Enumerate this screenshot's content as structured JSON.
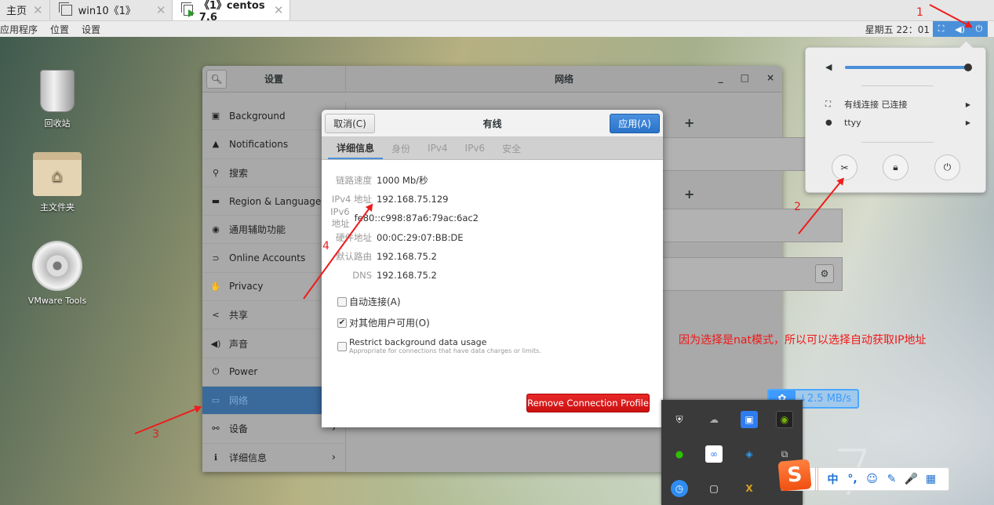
{
  "vmware_tabs": [
    {
      "label": "主页",
      "active": false
    },
    {
      "label": "win10《1》",
      "active": false
    },
    {
      "label": "《1》centos 7.6",
      "active": true
    }
  ],
  "topbar": {
    "menus": [
      "应用程序",
      "位置",
      "设置"
    ],
    "clock": "星期五 22：01",
    "icons": [
      "network-icon",
      "volume-icon",
      "power-icon"
    ]
  },
  "desktop_icons": [
    {
      "label": "回收站",
      "icon": "trash-icon"
    },
    {
      "label": "主文件夹",
      "icon": "home-folder-icon"
    },
    {
      "label": "VMware Tools",
      "icon": "cd-icon"
    }
  ],
  "settings": {
    "title_left": "设置",
    "title_right": "网络",
    "window_controls": {
      "minimize": "_",
      "maximize": "□",
      "close": "×"
    },
    "sidebar": [
      {
        "label": "Background",
        "icon": "background-icon",
        "icon_glyph": "▣"
      },
      {
        "label": "Notifications",
        "icon": "bell-icon",
        "icon_glyph": "▲"
      },
      {
        "label": "搜索",
        "icon": "search-icon",
        "icon_glyph": "⚲"
      },
      {
        "label": "Region & Language",
        "icon": "region-icon",
        "icon_glyph": "▬"
      },
      {
        "label": "通用辅助功能",
        "icon": "accessibility-icon",
        "icon_glyph": "◉"
      },
      {
        "label": "Online Accounts",
        "icon": "online-accounts-icon",
        "icon_glyph": "⊃"
      },
      {
        "label": "Privacy",
        "icon": "hand-icon",
        "icon_glyph": "✋"
      },
      {
        "label": "共享",
        "icon": "share-icon",
        "icon_glyph": "<"
      },
      {
        "label": "声音",
        "icon": "speaker-icon",
        "icon_glyph": "◀)"
      },
      {
        "label": "Power",
        "icon": "power-plug-icon",
        "icon_glyph": "⏻"
      },
      {
        "label": "网络",
        "icon": "network-icon",
        "icon_glyph": "▭",
        "active": true
      },
      {
        "label": "设备",
        "icon": "devices-icon",
        "icon_glyph": "⚯",
        "chevron": "›"
      },
      {
        "label": "详细信息",
        "icon": "info-icon",
        "icon_glyph": "ℹ",
        "chevron": "›"
      }
    ]
  },
  "dialog": {
    "title": "有线",
    "cancel_label": "取消(C)",
    "apply_label": "应用(A)",
    "tabs": [
      "详细信息",
      "身份",
      "IPv4",
      "IPv6",
      "安全"
    ],
    "active_tab": 0,
    "details": [
      {
        "key": "链路速度",
        "value": "1000 Mb/秒"
      },
      {
        "key": "IPv4 地址",
        "value": "192.168.75.129"
      },
      {
        "key": "IPv6 地址",
        "value": "fe80::c998:87a6:79ac:6ac2"
      },
      {
        "key": "硬件地址",
        "value": "00:0C:29:07:BB:DE"
      },
      {
        "key": "默认路由",
        "value": "192.168.75.2"
      },
      {
        "key": "DNS",
        "value": "192.168.75.2"
      }
    ],
    "checkboxes": [
      {
        "label": "自动连接(A)",
        "checked": false
      },
      {
        "label": "对其他用户可用(O)",
        "checked": true
      },
      {
        "label": "Restrict background data usage",
        "sublabel": "Appropriate for connections that have data charges or limits.",
        "checked": false
      }
    ],
    "remove_label": "Remove Connection Profile"
  },
  "system_menu": {
    "volume_percent": 100,
    "network_label": "有线连接 已连接",
    "user_label": "ttyy",
    "buttons": [
      "settings-icon",
      "lock-icon",
      "power-icon"
    ]
  },
  "annotations": {
    "labels": [
      "1",
      "2",
      "3",
      "4"
    ],
    "note": "因为选择是nat模式，所以可以选择自动获取IP地址"
  },
  "tray": {
    "speed": "↓2.5 MB/s",
    "ime_items": [
      "中",
      "°,",
      "☺",
      "✎",
      "🎤",
      "▦"
    ]
  },
  "colors": {
    "accent": "#4a90d9",
    "sidebar_active": "#3a6a9c",
    "danger": "#e01e1e",
    "annotation": "#ee1c1c"
  }
}
